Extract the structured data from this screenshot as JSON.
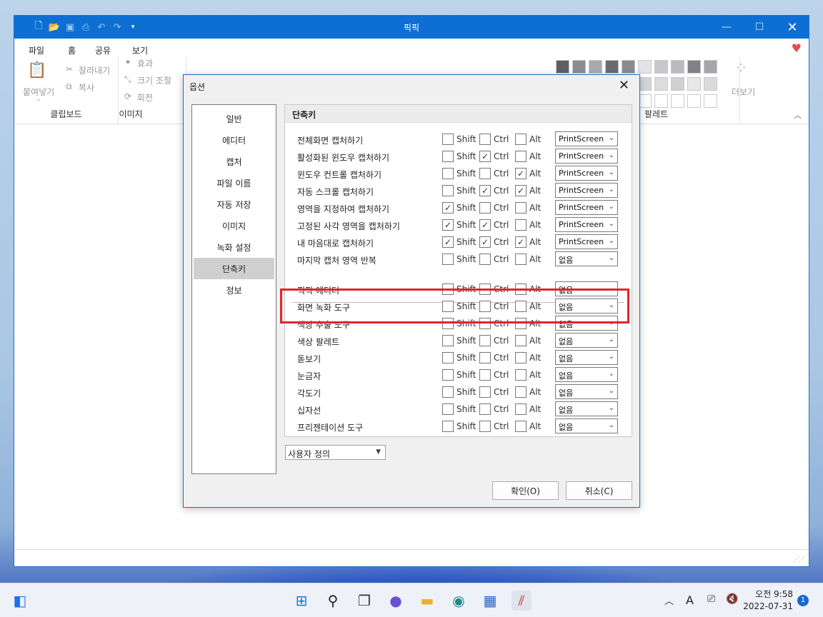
{
  "app": {
    "title": "픽픽",
    "menu": [
      "파일",
      "홈",
      "공유",
      "보기"
    ],
    "ribbon": {
      "clipboard": {
        "paste": "붙여넣기",
        "cut": "잘라내기",
        "copy": "복사",
        "label": "클립보드"
      },
      "image": {
        "effect": "효과",
        "resize": "크기 조절",
        "rotate": "회전",
        "label": "이미지"
      },
      "palette": {
        "more": "더보기",
        "label": "팔레트"
      }
    }
  },
  "dialog": {
    "title": "옵션",
    "nav": [
      "일반",
      "에디터",
      "캡처",
      "파일 이름",
      "자동 저장",
      "이미지",
      "녹화 설정",
      "단축키",
      "정보"
    ],
    "selected_nav": "단축키",
    "panel_title": "단축키",
    "modifier_labels": {
      "shift": "Shift",
      "ctrl": "Ctrl",
      "alt": "Alt"
    },
    "rows_capture": [
      {
        "label": "전체화면 캡처하기",
        "shift": false,
        "ctrl": false,
        "alt": false,
        "key": "PrintScreen"
      },
      {
        "label": "활성화된 윈도우 캡처하기",
        "shift": false,
        "ctrl": true,
        "alt": false,
        "key": "PrintScreen"
      },
      {
        "label": "윈도우 컨트롤 캡처하기",
        "shift": false,
        "ctrl": false,
        "alt": true,
        "key": "PrintScreen"
      },
      {
        "label": "자동 스크롤 캡처하기",
        "shift": false,
        "ctrl": true,
        "alt": true,
        "key": "PrintScreen"
      },
      {
        "label": "영역을 지정하여 캡처하기",
        "shift": true,
        "ctrl": false,
        "alt": false,
        "key": "PrintScreen"
      },
      {
        "label": "고정된 사각 영역을 캡처하기",
        "shift": true,
        "ctrl": true,
        "alt": false,
        "key": "PrintScreen"
      },
      {
        "label": "내 마음대로 캡처하기",
        "shift": true,
        "ctrl": true,
        "alt": true,
        "key": "PrintScreen"
      },
      {
        "label": "마지막 캡처 영역 반복",
        "shift": false,
        "ctrl": false,
        "alt": false,
        "key": "없음"
      }
    ],
    "rows_tools": [
      {
        "label": "픽픽 에디터",
        "shift": false,
        "ctrl": false,
        "alt": false,
        "key": "없음"
      },
      {
        "label": "화면 녹화 도구",
        "shift": false,
        "ctrl": false,
        "alt": false,
        "key": "없음"
      },
      {
        "label": "색상 추출 도구",
        "shift": false,
        "ctrl": false,
        "alt": false,
        "key": "없음"
      },
      {
        "label": "색상 팔레트",
        "shift": false,
        "ctrl": false,
        "alt": false,
        "key": "없음"
      },
      {
        "label": "돋보기",
        "shift": false,
        "ctrl": false,
        "alt": false,
        "key": "없음"
      },
      {
        "label": "눈금자",
        "shift": false,
        "ctrl": false,
        "alt": false,
        "key": "없음"
      },
      {
        "label": "각도기",
        "shift": false,
        "ctrl": false,
        "alt": false,
        "key": "없음"
      },
      {
        "label": "십자선",
        "shift": false,
        "ctrl": false,
        "alt": false,
        "key": "없음"
      },
      {
        "label": "프리젠테이션 도구",
        "shift": false,
        "ctrl": false,
        "alt": false,
        "key": "없음"
      }
    ],
    "preset": "사용자 정의",
    "ok_label": "확인(O)",
    "cancel_label": "취소(C)"
  },
  "taskbar": {
    "time": "오전 9:58",
    "date": "2022-07-31",
    "ime": "A",
    "notifications": "1"
  },
  "colors": {
    "accent": "#0d6fd3",
    "highlight": "#e0252b"
  }
}
